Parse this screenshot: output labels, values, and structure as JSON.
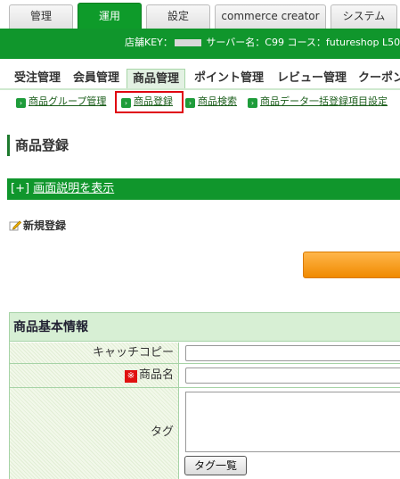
{
  "top_tabs": [
    {
      "label": "管理",
      "active": false
    },
    {
      "label": "運用",
      "active": true
    },
    {
      "label": "設定",
      "active": false
    },
    {
      "label": "commerce creator",
      "active": false
    },
    {
      "label": "システム",
      "active": false
    }
  ],
  "header": {
    "shop_key_label": "店舗KEY：",
    "server_info": "サーバー名：C99 コース：futureshop L50"
  },
  "main_nav": [
    "受注管理",
    "会員管理",
    "商品管理",
    "ポイント管理",
    "レビュー管理",
    "クーポン"
  ],
  "sub_nav": [
    "商品グループ管理",
    "商品登録",
    "商品検索",
    "商品データ一括登録項目設定"
  ],
  "page": {
    "title": "商品登録",
    "help_prefix": "[+]",
    "help_link": "画面説明を表示",
    "new_registration": "新規登録"
  },
  "section": {
    "title": "商品基本情報",
    "fields": {
      "catch_copy": "キャッチコピー",
      "required_mark": "※",
      "product_name": "商品名",
      "tag": "タグ",
      "tag_list_button": "タグ一覧"
    }
  },
  "colors": {
    "brand_green": "#10962c",
    "highlight_red": "#e00010",
    "primary_button": "#f08a00"
  }
}
